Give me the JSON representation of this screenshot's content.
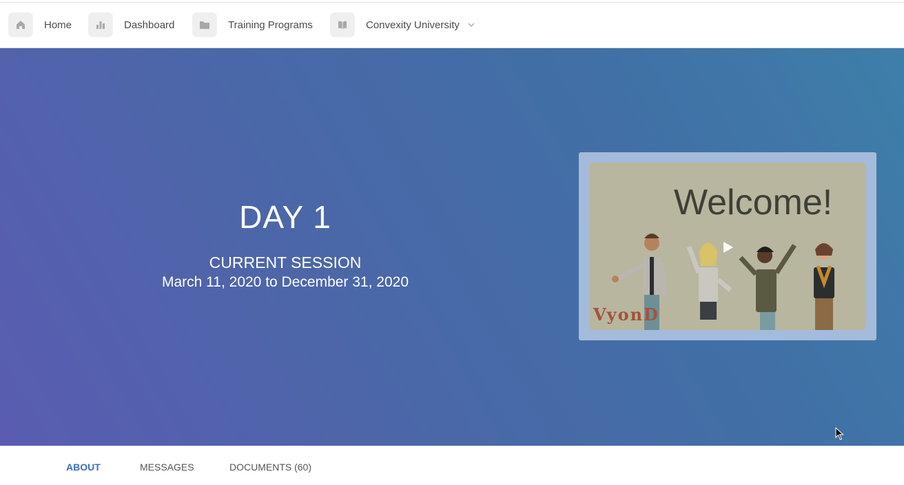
{
  "nav": {
    "items": [
      {
        "label": "Home",
        "icon": "home-icon"
      },
      {
        "label": "Dashboard",
        "icon": "bar-chart-icon"
      },
      {
        "label": "Training Programs",
        "icon": "folder-icon"
      },
      {
        "label": "Convexity University",
        "icon": "book-icon"
      }
    ],
    "dropdown_icon": "chevron-down-icon"
  },
  "hero": {
    "title": "DAY 1",
    "session_label": "CURRENT SESSION",
    "session_dates": "March 11, 2020 to December 31, 2020",
    "background_colors": [
      "#5a5cb1",
      "#3e7fa9"
    ]
  },
  "video": {
    "thumbnail_text": "Welcome!",
    "watermark": "VyonD",
    "play_icon": "play-icon"
  },
  "tabs": [
    {
      "label": "ABOUT",
      "active": true
    },
    {
      "label": "MESSAGES",
      "active": false
    },
    {
      "label": "DOCUMENTS (60)",
      "active": false
    }
  ],
  "colors": {
    "accent": "#3a6fc4",
    "nav_icon_bg": "#efefef"
  }
}
